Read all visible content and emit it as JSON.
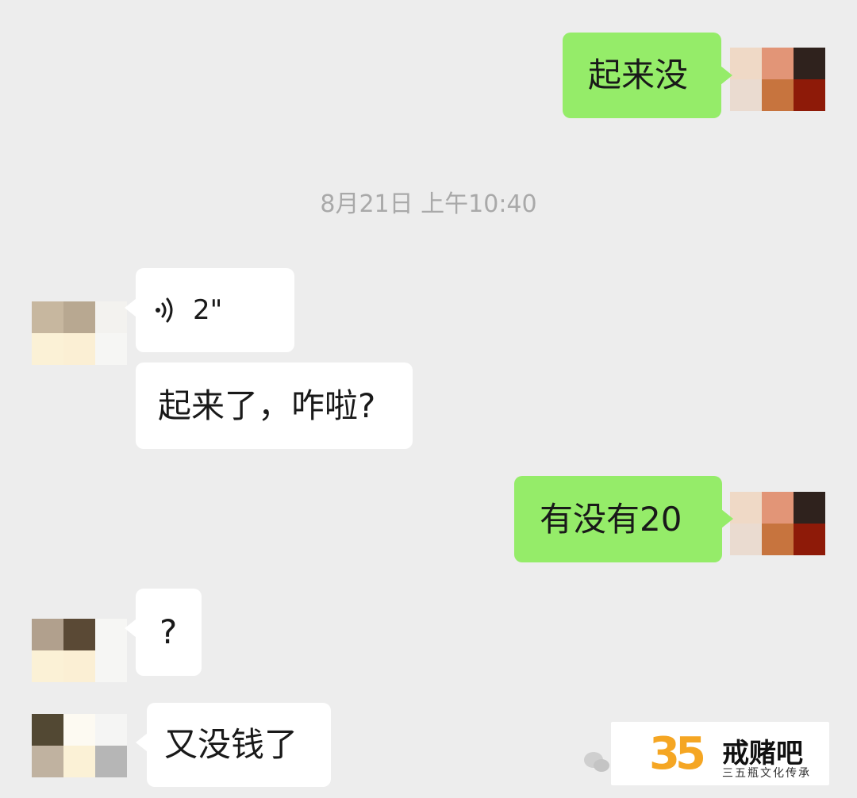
{
  "timestamp": "8月21日 上午10:40",
  "messages": [
    {
      "side": "out",
      "text": "起来没"
    },
    {
      "side": "in",
      "type": "voice",
      "duration": "2\""
    },
    {
      "side": "in",
      "text": "起来了，咋啦?"
    },
    {
      "side": "out",
      "text": "有没有20"
    },
    {
      "side": "in",
      "text": "?"
    },
    {
      "side": "in",
      "text": "又没钱了"
    }
  ],
  "watermark": {
    "logo_number": "35",
    "title": "戒赌吧",
    "subtitle": "三五瓶文化传承"
  },
  "colors": {
    "background": "#ededed",
    "outgoing_bubble": "#95ec69",
    "incoming_bubble": "#ffffff",
    "timestamp_text": "#a9a9a9"
  },
  "icons": {
    "voice": "voice-wave-icon",
    "watermark_chat": "wechat-icon"
  }
}
